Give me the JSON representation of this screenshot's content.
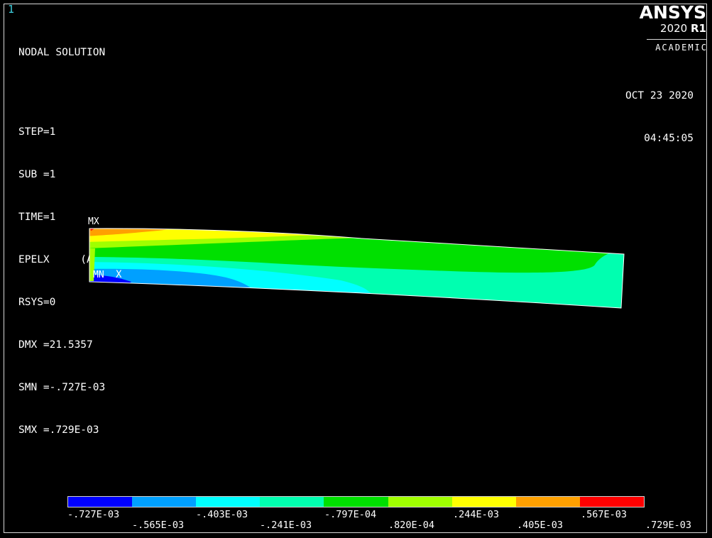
{
  "window": {
    "number": "1"
  },
  "info": {
    "title": "NODAL SOLUTION",
    "lines": [
      "STEP=1",
      "SUB =1",
      "TIME=1",
      "EPELX     (AVG)",
      "RSYS=0",
      "DMX =21.5357",
      "SMN =-.727E-03",
      "SMX =.729E-03"
    ]
  },
  "logo": {
    "name": "ANSYS",
    "version_year": "2020",
    "version_release": "R1",
    "edition": "ACADEMIC"
  },
  "datetime": {
    "date": "OCT 23 2020",
    "time": "04:45:05"
  },
  "markers": {
    "max": "MX",
    "min": "MN",
    "axis": "X"
  },
  "legend": {
    "colors": [
      "#0000ff",
      "#00a0ff",
      "#00ffff",
      "#00ffb0",
      "#00e000",
      "#a0ff00",
      "#ffff00",
      "#ffa000",
      "#ff0000"
    ],
    "labels_bottom_row": [
      "-.727E-03",
      "-.403E-03",
      "-.797E-04",
      ".244E-03",
      ".567E-03"
    ],
    "labels_top_row": [
      "-.565E-03",
      "-.241E-03",
      ".820E-04",
      ".405E-03",
      ".729E-03"
    ]
  }
}
